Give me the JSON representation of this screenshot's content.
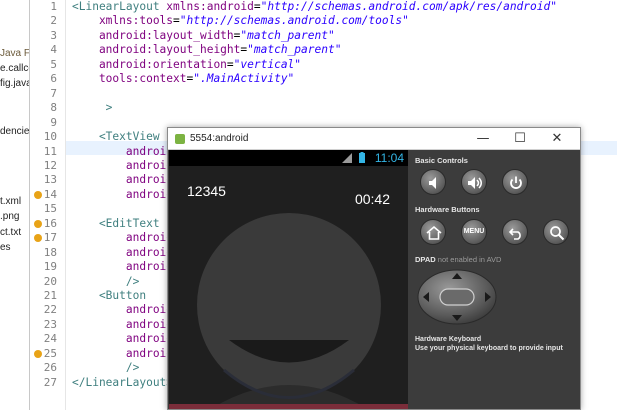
{
  "explorer": {
    "items": [
      {
        "label": "Java F",
        "muted": true
      },
      {
        "label": "e.callco",
        "muted": false
      },
      {
        "label": "fig.java",
        "muted": false
      },
      {
        "label": "dencies",
        "muted": false
      },
      {
        "label": "t.xml",
        "muted": false
      },
      {
        "label": ".png",
        "muted": false
      },
      {
        "label": "ct.txt",
        "muted": false
      },
      {
        "label": "es",
        "muted": false
      }
    ]
  },
  "editor": {
    "line_numbers": [
      "1",
      "2",
      "3",
      "4",
      "5",
      "6",
      "7",
      "8",
      "9",
      "10",
      "11",
      "12",
      "13",
      "14",
      "15",
      "16",
      "17",
      "18",
      "19",
      "20",
      "21",
      "22",
      "23",
      "24",
      "25",
      "26",
      "27"
    ],
    "lines": [
      [
        {
          "t": "<LinearLayout ",
          "c": "tag"
        },
        {
          "t": "xmlns:android",
          "c": "attr"
        },
        {
          "t": "=",
          "c": "plain"
        },
        {
          "t": "\"http://schemas.android.com/apk/res/android\"",
          "c": "val"
        }
      ],
      [
        {
          "t": "    xmlns:tools",
          "c": "attr"
        },
        {
          "t": "=",
          "c": "plain"
        },
        {
          "t": "\"http://schemas.android.com/tools\"",
          "c": "val"
        }
      ],
      [
        {
          "t": "    android:layout_width",
          "c": "attr"
        },
        {
          "t": "=",
          "c": "plain"
        },
        {
          "t": "\"match_parent\"",
          "c": "val"
        }
      ],
      [
        {
          "t": "    android:layout_height",
          "c": "attr"
        },
        {
          "t": "=",
          "c": "plain"
        },
        {
          "t": "\"match_parent\"",
          "c": "val"
        }
      ],
      [
        {
          "t": "    android:orientation",
          "c": "attr"
        },
        {
          "t": "=",
          "c": "plain"
        },
        {
          "t": "\"vertical\"",
          "c": "val"
        }
      ],
      [
        {
          "t": "    tools:context",
          "c": "attr"
        },
        {
          "t": "=",
          "c": "plain"
        },
        {
          "t": "\".MainActivity\"",
          "c": "val"
        }
      ],
      [],
      [
        {
          "t": "     >",
          "c": "tag"
        }
      ],
      [],
      [
        {
          "t": "    <TextView",
          "c": "tag"
        }
      ],
      [
        {
          "t": "        android",
          "c": "attr"
        }
      ],
      [
        {
          "t": "        android",
          "c": "attr"
        }
      ],
      [
        {
          "t": "        android",
          "c": "attr"
        }
      ],
      [
        {
          "t": "        android",
          "c": "attr"
        }
      ],
      [],
      [
        {
          "t": "    <EditText",
          "c": "tag"
        }
      ],
      [
        {
          "t": "        android:",
          "c": "attr"
        }
      ],
      [
        {
          "t": "        android:",
          "c": "attr"
        }
      ],
      [
        {
          "t": "        android:",
          "c": "attr"
        }
      ],
      [
        {
          "t": "        />",
          "c": "tag"
        }
      ],
      [
        {
          "t": "    <Button",
          "c": "tag"
        }
      ],
      [
        {
          "t": "        android",
          "c": "attr"
        }
      ],
      [
        {
          "t": "        android",
          "c": "attr"
        }
      ],
      [
        {
          "t": "        android",
          "c": "attr"
        }
      ],
      [
        {
          "t": "        android",
          "c": "attr"
        }
      ],
      [
        {
          "t": "        />",
          "c": "tag"
        }
      ],
      [
        {
          "t": "</LinearLayout>",
          "c": "tag"
        }
      ]
    ]
  },
  "emulator": {
    "title": "5554:android",
    "minimize": "—",
    "maximize": "☐",
    "close": "✕",
    "phone": {
      "clock": "11:04",
      "call_number": "12345",
      "call_timer": "00:42"
    },
    "controls": {
      "basic_controls_label": "Basic Controls",
      "hardware_buttons_label": "Hardware Buttons",
      "menu_label": "MENU",
      "dpad_label": "DPAD",
      "dpad_note": "not enabled in AVD",
      "keyboard_label": "Hardware Keyboard",
      "keyboard_hint": "Use your physical keyboard to provide input"
    }
  },
  "colors": {
    "xml_tag": "#3f7f7f",
    "xml_attr": "#7f007f",
    "xml_value": "#2a00ff",
    "current_line": "#e8f2fe",
    "clock_blue": "#33b5e5",
    "warning": "#e8a317"
  }
}
